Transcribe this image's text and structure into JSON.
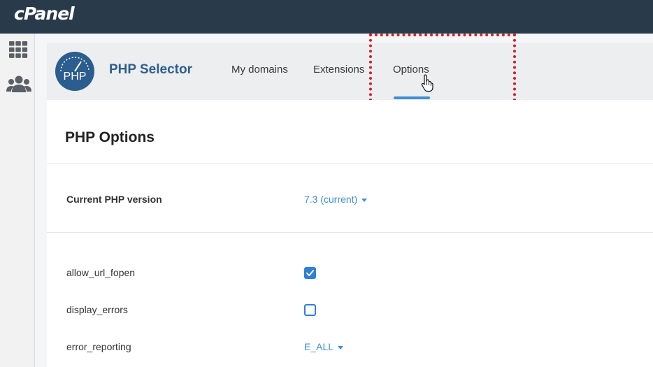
{
  "app": {
    "brand": "cPanel",
    "title": "PHP Selector",
    "logo_text": "PHP"
  },
  "tabs": [
    {
      "label": "My domains"
    },
    {
      "label": "Extensions"
    },
    {
      "label": "Options",
      "active": true
    }
  ],
  "page": {
    "title": "PHP Options",
    "current_version_label": "Current PHP version",
    "current_version_value": "7.3 (current)"
  },
  "options": [
    {
      "name": "allow_url_fopen",
      "type": "checkbox",
      "checked": true
    },
    {
      "name": "display_errors",
      "type": "checkbox",
      "checked": false
    },
    {
      "name": "error_reporting",
      "type": "select",
      "value": "E_ALL"
    }
  ],
  "colors": {
    "topbar": "#293a4a",
    "accent": "#3f8fd8",
    "brand_title": "#2f5e8e",
    "highlight": "#d21f26"
  },
  "icons": [
    "apps-grid-icon",
    "users-icon",
    "php-logo",
    "pointer-cursor-icon",
    "caret-down-icon",
    "checkmark-icon"
  ]
}
